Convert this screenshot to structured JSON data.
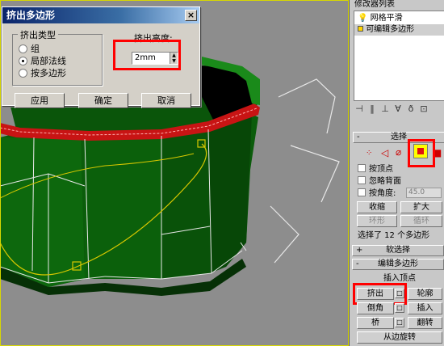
{
  "dialog": {
    "title": "挤出多边形",
    "close_glyph": "×",
    "group_title": "挤出类型",
    "options": [
      "组",
      "局部法线",
      "按多边形"
    ],
    "selected_option": "局部法线",
    "height_label": "挤出高度:",
    "height_value": "2mm",
    "buttons": {
      "apply": "应用",
      "ok": "确定",
      "cancel": "取消"
    }
  },
  "panel": {
    "modifier_list_label": "修改器列表",
    "stack": [
      {
        "label": "网格平滑",
        "icon": "lightbulb-icon"
      },
      {
        "label": "可编辑多边形",
        "icon": "square-icon"
      }
    ],
    "toolbar_icons": [
      "pin-icon",
      "pipe-icon",
      "show-result-icon",
      "make-unique-icon",
      "remove-modifier-icon",
      "configure-icon"
    ],
    "selection": {
      "title": "选择",
      "subobject_icons": [
        "vertex-icon",
        "edge-icon",
        "border-icon",
        "polygon-icon",
        "element-icon"
      ],
      "active_subobject": "polygon-icon",
      "by_vertex": "按顶点",
      "ignore_backfacing": "忽略背面",
      "by_angle": "按角度:",
      "angle_value": "45.0",
      "shrink": "收缩",
      "grow": "扩大",
      "ring": "环形",
      "loop": "循环",
      "status": "选择了 12 个多边形"
    },
    "soft_selection": {
      "title": "软选择"
    },
    "edit_polygons": {
      "title": "编辑多边形",
      "insert_vertex": "插入顶点",
      "extrude": "挤出",
      "outline": "轮廓",
      "bevel": "倒角",
      "inset": "插入",
      "bridge": "桥",
      "flip": "翻转",
      "hinge_from_edge": "从边旋转",
      "settings_glyph": "□"
    },
    "rollout_minus": "-",
    "rollout_plus": "+"
  },
  "colors": {
    "highlight": "#ff0000",
    "object_green": "#0a5a0a",
    "selected_band": "#c81414",
    "active_subobject_bg": "#ffff00"
  }
}
